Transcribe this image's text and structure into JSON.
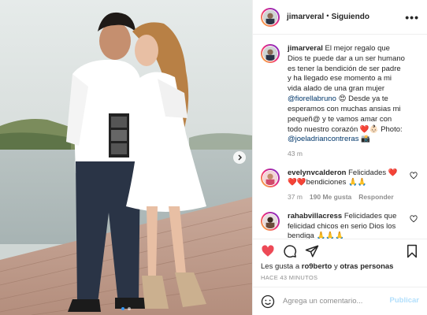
{
  "post": {
    "username": "jimarveral",
    "follow_status": "Siguiendo",
    "separator": "•",
    "more_label": "•••"
  },
  "caption": {
    "username": "jimarveral",
    "text_1": "El mejor regalo que Dios te puede dar a un ser humano es tener la bendición de ser padre y ha llegado ese momento a mi vida alado de una gran mujer ",
    "mention_1": "@fiorellabruno",
    "text_2": " 😍 Desde ya te esperamos con muchas ansias mi pequeñ@ y te vamos amar con todo nuestro corazón ❤️👶🏻 Photo: ",
    "mention_2": "@joeladriancontreras",
    "text_3": " 📸",
    "time": "43 m"
  },
  "comments": [
    {
      "username": "evelynvcalderon",
      "text": " Felicidades ❤️❤️❤️bendiciones 🙏🙏",
      "time": "37 m",
      "likes": "190 Me gusta",
      "reply": "Responder"
    },
    {
      "username": "rahabvillacress",
      "text": " Felicidades que felicidad chicos en serio Dios los bendiga 🙏🙏🙏"
    }
  ],
  "likes_line": {
    "prefix": "Les gusta a ",
    "user": "ro9berto",
    "middle": " y ",
    "others": "otras personas"
  },
  "timestamp": "HACE 43 MINUTOS",
  "add_comment": {
    "placeholder": "Agrega un comentario...",
    "publish_label": "Publicar"
  },
  "colors": {
    "like_red": "#ed4956",
    "link_blue": "#00376b",
    "active_dot": "#3897f0",
    "publish_disabled": "#b2dffc"
  },
  "icons": [
    "more-options-icon",
    "heart-icon",
    "comment-icon",
    "share-icon",
    "bookmark-icon",
    "emoji-icon",
    "chevron-right-icon"
  ]
}
